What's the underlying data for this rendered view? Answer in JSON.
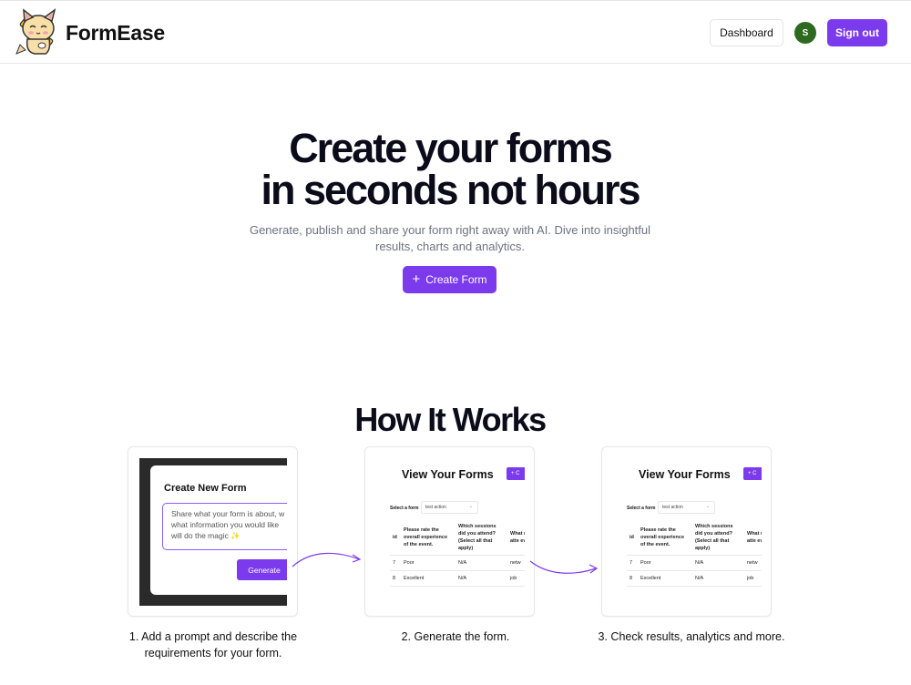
{
  "header": {
    "brand": "FormEase",
    "dashboard_label": "Dashboard",
    "avatar_initial": "S",
    "signout_label": "Sign out"
  },
  "hero": {
    "title_line1": "Create your forms",
    "title_line2": "in seconds not hours",
    "subtitle": "Generate, publish and share your form right away with AI. Dive into insightful results, charts and analytics.",
    "create_label": "Create Form"
  },
  "how": {
    "title": "How It Works",
    "step1": {
      "modal_title": "Create New Form",
      "placeholder_lines": [
        "Share what your form is about, w",
        "what information you would like",
        "will do the magic ✨"
      ],
      "generate_label": "Generate",
      "caption": "1. Add a prompt and describe the requirements for your form."
    },
    "step2": {
      "caption": "2. Generate the form."
    },
    "step3": {
      "caption": "3. Check results, analytics and more."
    },
    "table_preview": {
      "title": "View Your Forms",
      "button": "+ C",
      "select_label": "Select a form",
      "select_value": "test action",
      "columns": [
        "id",
        "Please rate the overall experience of the event.",
        "Which sessions did you attend? (Select all that apply)",
        "What main atte even"
      ],
      "rows": [
        [
          "7",
          "Poor",
          "N/A",
          "netw"
        ],
        [
          "8",
          "Excellent",
          "N/A",
          "job"
        ]
      ]
    }
  },
  "colors": {
    "accent": "#7c3aed",
    "avatar": "#2d6a1f",
    "text": "#0b0b1a",
    "muted": "#6b7280"
  }
}
